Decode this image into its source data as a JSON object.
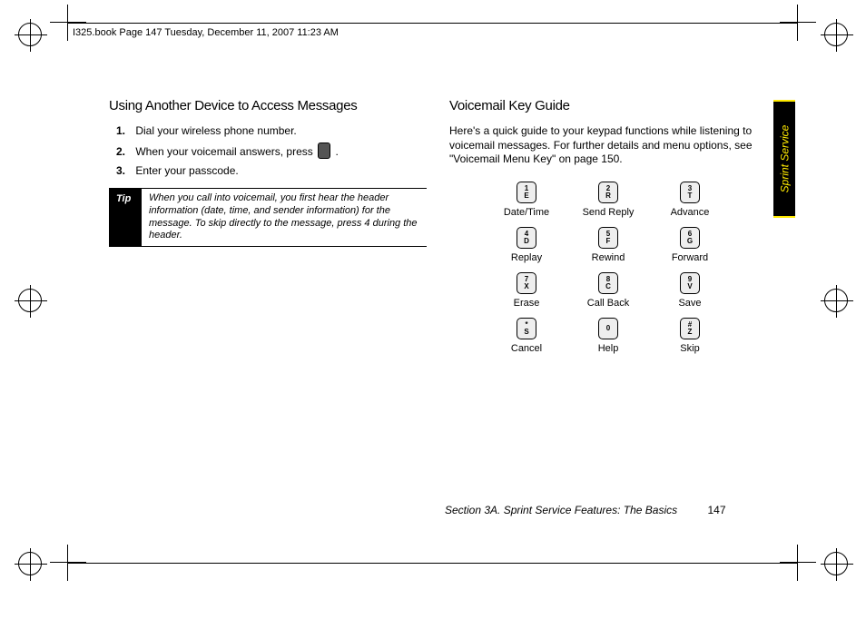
{
  "header": "I325.book  Page 147  Tuesday, December 11, 2007  11:23 AM",
  "side_tab": "Sprint Service",
  "left": {
    "heading": "Using Another Device to Access Messages",
    "steps": [
      {
        "n": "1.",
        "text": "Dial your wireless phone number."
      },
      {
        "n": "2.",
        "text_before": "When your voicemail answers, press ",
        "text_after": "."
      },
      {
        "n": "3.",
        "text": "Enter your passcode."
      }
    ],
    "tip_label": "Tip",
    "tip_text": "When you call into voicemail, you first hear the header information (date, time, and sender information) for the message. To skip directly to the message, press 4 during the header."
  },
  "right": {
    "heading": "Voicemail Key Guide",
    "intro": "Here's a quick guide to your keypad functions while listening to voicemail messages. For further details and menu options, see \"Voicemail Menu Key\" on page 150.",
    "keys": [
      {
        "top": "1",
        "bot": "E",
        "label": "Date/Time"
      },
      {
        "top": "2",
        "bot": "R",
        "label": "Send Reply"
      },
      {
        "top": "3",
        "bot": "T",
        "label": "Advance"
      },
      {
        "top": "4",
        "bot": "D",
        "label": "Replay"
      },
      {
        "top": "5",
        "bot": "F",
        "label": "Rewind"
      },
      {
        "top": "6",
        "bot": "G",
        "label": "Forward"
      },
      {
        "top": "7",
        "bot": "X",
        "label": "Erase"
      },
      {
        "top": "8",
        "bot": "C",
        "label": "Call Back"
      },
      {
        "top": "9",
        "bot": "V",
        "label": "Save"
      },
      {
        "top": "*",
        "bot": "S",
        "label": "Cancel"
      },
      {
        "top": "0",
        "bot": "",
        "label": "Help"
      },
      {
        "top": "#",
        "bot": "Z",
        "label": "Skip"
      }
    ]
  },
  "footer": {
    "section": "Section 3A. Sprint Service Features: The Basics",
    "page": "147"
  }
}
